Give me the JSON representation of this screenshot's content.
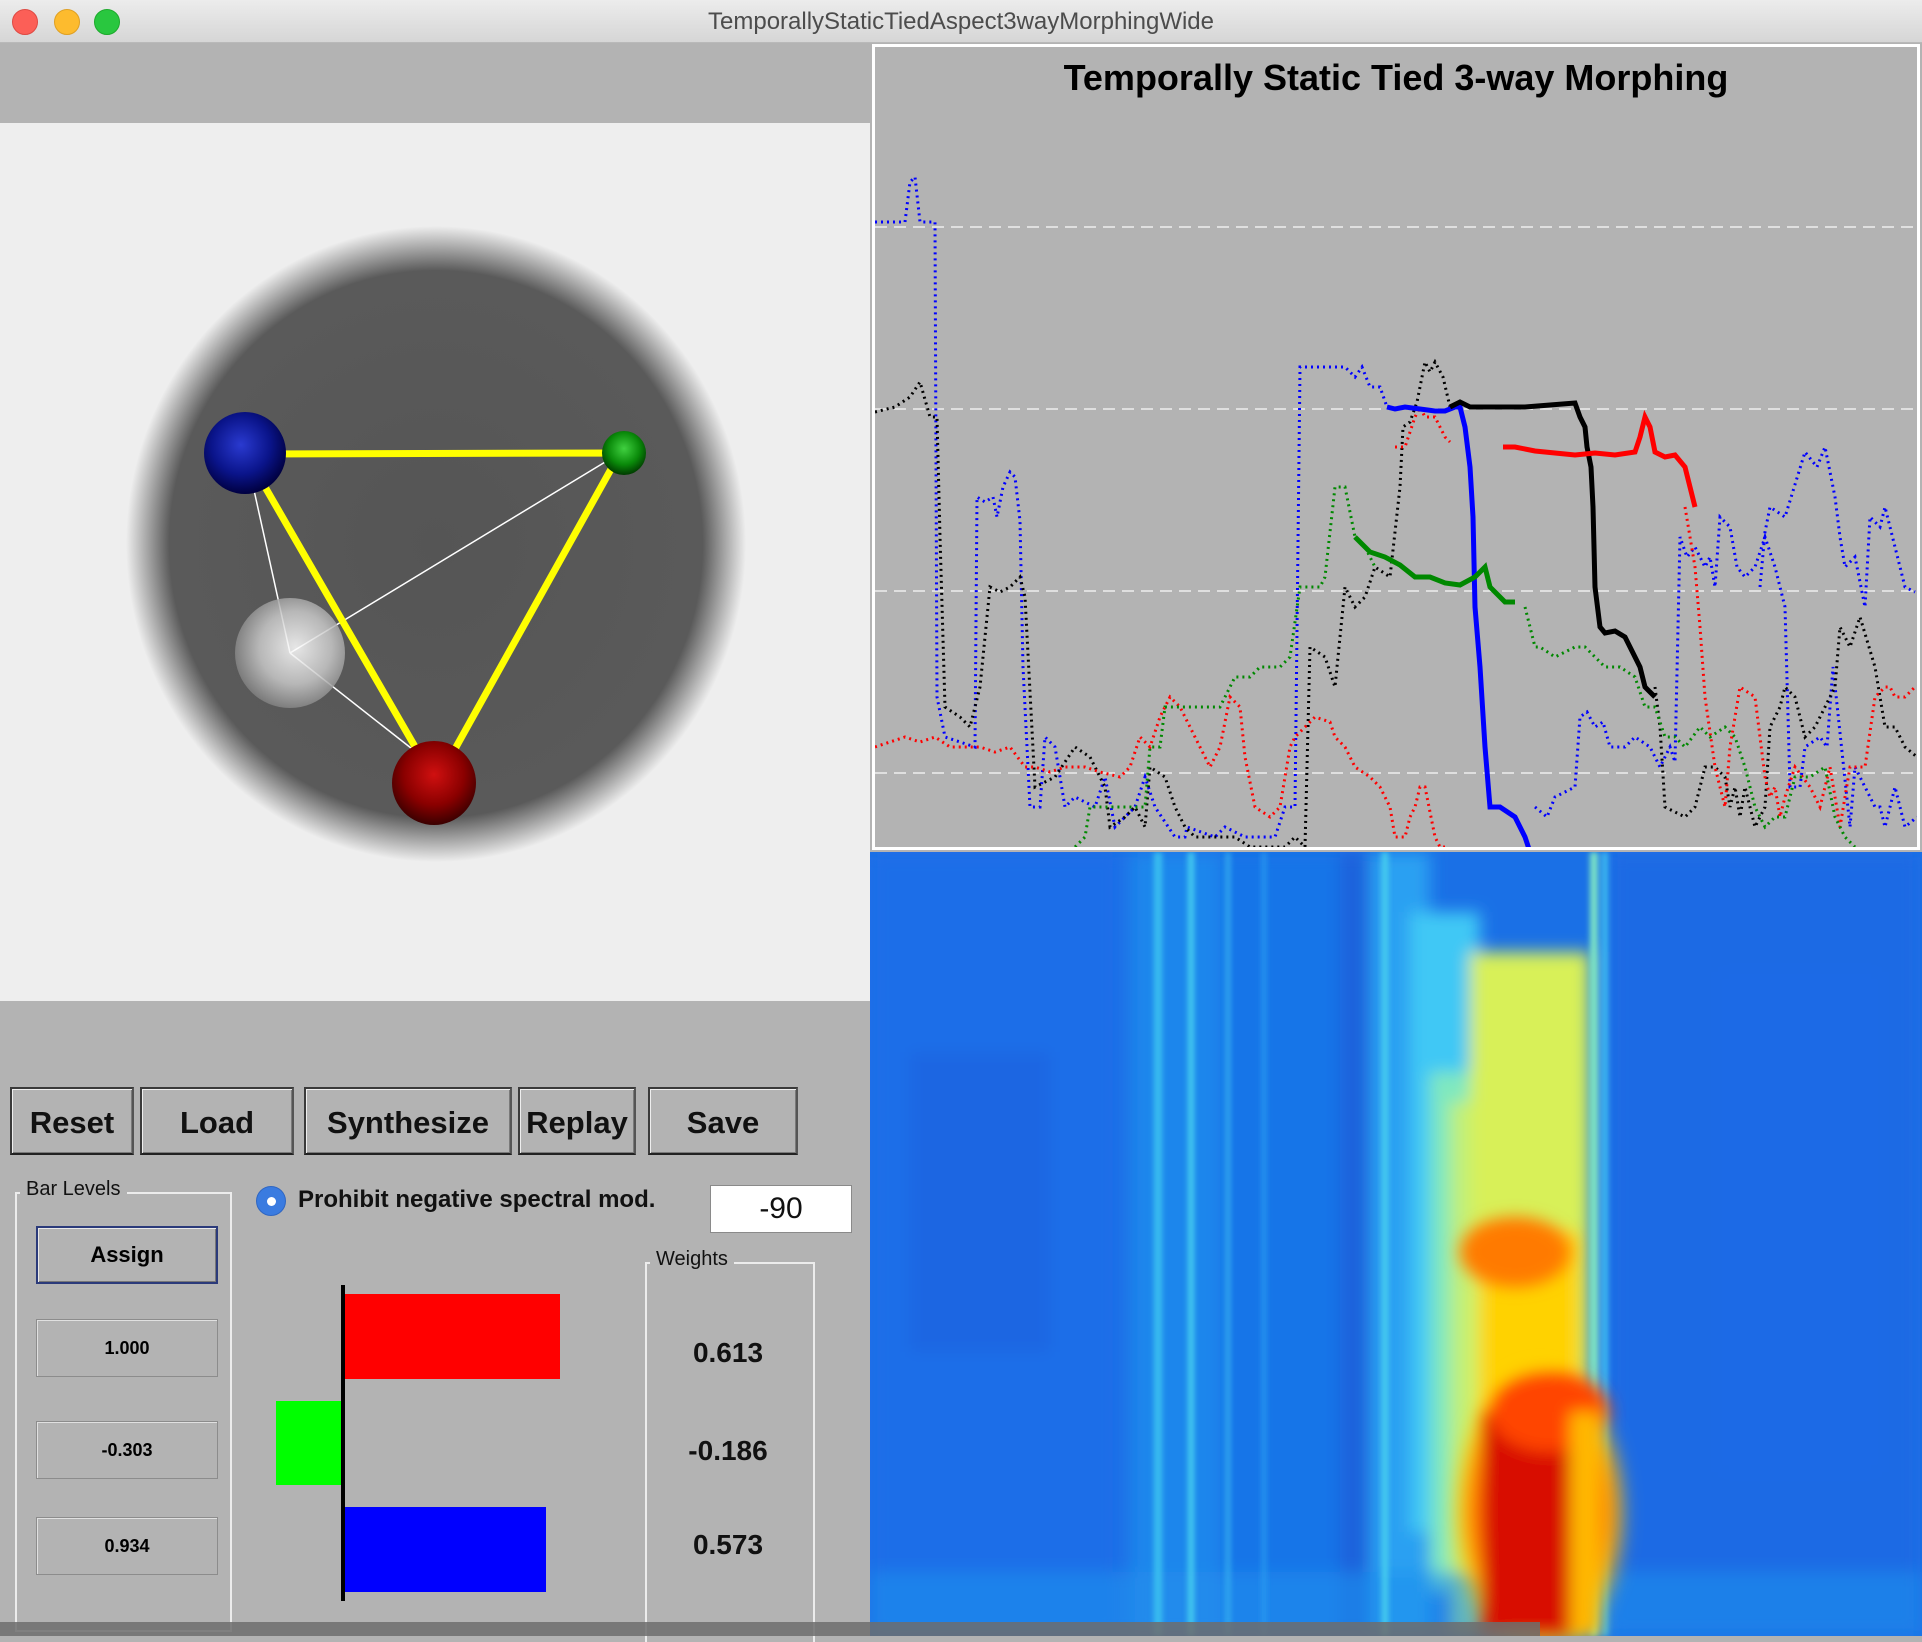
{
  "window": {
    "title": "TemporallyStaticTiedAspect3wayMorphingWide"
  },
  "toolbar": {
    "reset_label": "Reset",
    "load_label": "Load",
    "synthesize_label": "Synthesize",
    "replay_label": "Replay",
    "save_label": "Save"
  },
  "bar_levels": {
    "title": "Bar Levels",
    "assign_label": "Assign",
    "values": [
      "1.000",
      "-0.303",
      "0.934"
    ]
  },
  "options": {
    "prohibit_label": "Prohibit negative spectral mod.",
    "prohibit_checked": true,
    "db_floor_value": "-90"
  },
  "weights": {
    "title": "Weights",
    "values": [
      "0.613",
      "-0.186",
      "0.573"
    ],
    "numeric": [
      0.613,
      -0.186,
      0.573
    ],
    "colors": [
      "#ff0000",
      "#00ff00",
      "#0000ff"
    ]
  },
  "plot": {
    "title": "Temporally Static Tied 3-way Morphing",
    "series_colors": [
      "#0000ff",
      "#000000",
      "#ff0000",
      "#008800"
    ]
  },
  "sphere": {
    "node_colors": [
      "#00008b",
      "#00aa00",
      "#aa0000",
      "#cccccc"
    ],
    "edge_color": "#ffff00"
  }
}
